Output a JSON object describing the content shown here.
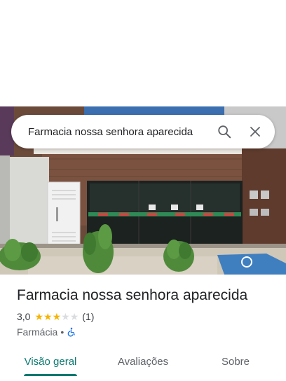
{
  "search": {
    "query": "Farmacia nossa senhora aparecida"
  },
  "place": {
    "name": "Farmacia nossa senhora aparecida",
    "rating": "3,0",
    "rating_value": 3,
    "rating_max": 5,
    "review_count": "(1)",
    "category": "Farmácia",
    "separator": "•"
  },
  "tabs": [
    {
      "label": "Visão geral",
      "active": true
    },
    {
      "label": "Avaliações",
      "active": false
    },
    {
      "label": "Sobre",
      "active": false
    }
  ],
  "colors": {
    "accent": "#0b7a71",
    "star": "#f6b400",
    "accessibility": "#1a73e8"
  },
  "icons": {
    "search": "search-icon",
    "close": "close-icon",
    "accessibility": "wheelchair-icon"
  }
}
